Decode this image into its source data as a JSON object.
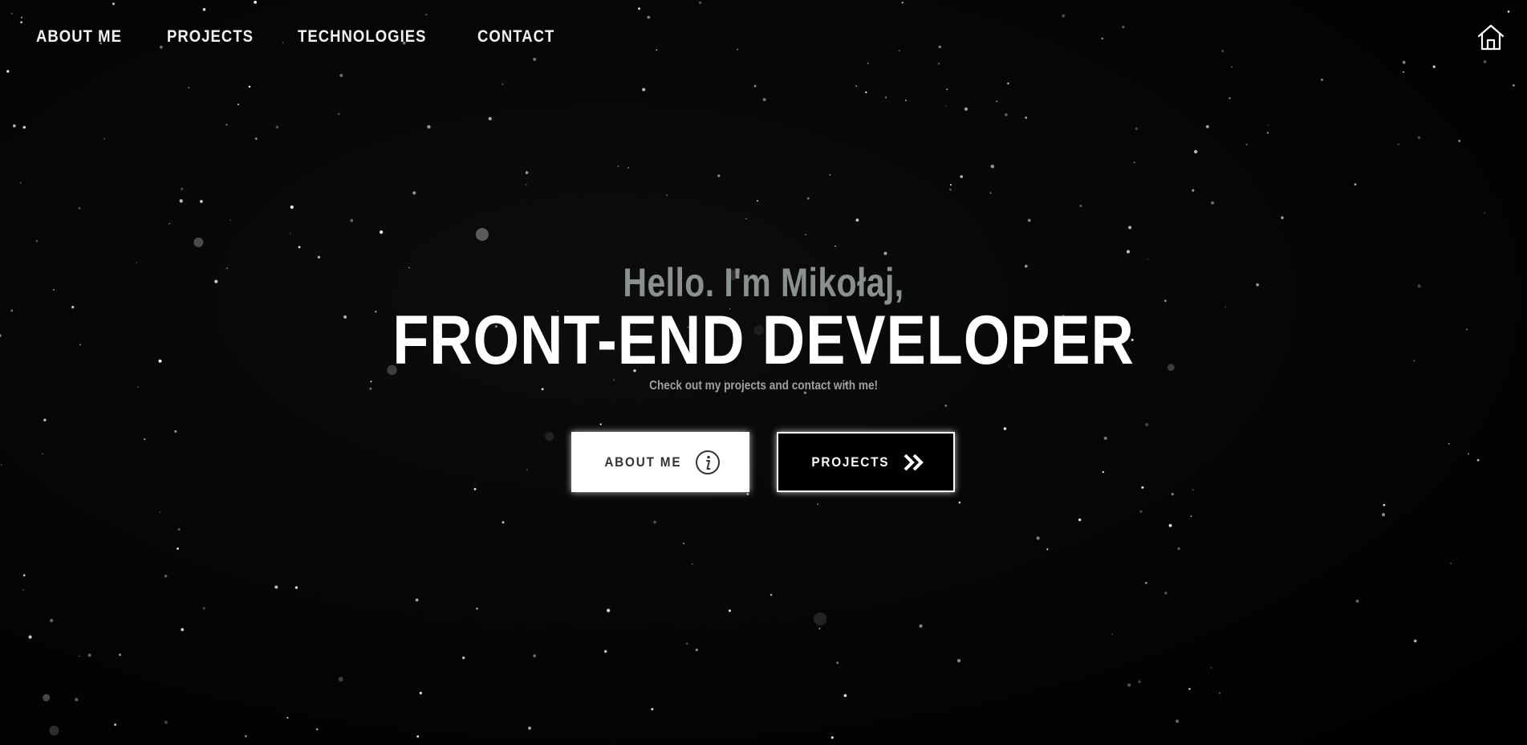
{
  "nav": {
    "items": [
      {
        "label": "ABOUT ME"
      },
      {
        "label": "PROJECTS"
      },
      {
        "label": "TECHNOLOGIES"
      },
      {
        "label": "CONTACT"
      }
    ],
    "home_icon": "home-icon"
  },
  "hero": {
    "greeting": "Hello. I'm Mikołaj,",
    "title": "FRONT-END DEVELOPER",
    "subtitle": "Check out my projects and contact with me!"
  },
  "buttons": {
    "about": {
      "label": "ABOUT ME",
      "icon": "info-icon"
    },
    "projects": {
      "label": "PROJECTS",
      "icon": "double-chevron-right-icon"
    }
  },
  "colors": {
    "background": "#000000",
    "greeting": "#8a9090",
    "text": "#ffffff"
  }
}
